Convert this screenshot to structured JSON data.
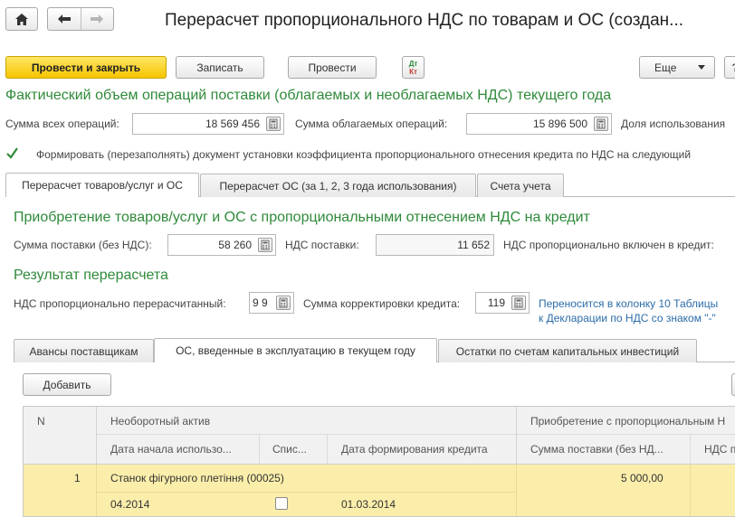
{
  "window": {
    "title": "Перерасчет пропорционального НДС по товарам и ОС (создан..."
  },
  "toolbar": {
    "post_close_label": "Провести и закрыть",
    "save_label": "Записать",
    "post_label": "Провести",
    "dt_kt_label_top": "Дт",
    "dt_kt_label_bottom": "Кт",
    "more_label": "Еще",
    "help_label": "?"
  },
  "section_main": {
    "heading": "Фактический объем операций поставки (облагаемых и необлагаемых НДС) текущего года",
    "sum_all_label": "Сумма всех операций:",
    "sum_all_value": "18 569 456",
    "sum_taxable_label": "Сумма облагаемых операций:",
    "sum_taxable_value": "15 896 500",
    "share_label": "Доля использования",
    "checkbox_checked": true,
    "checkbox_label": "Формировать (перезаполнять) документ установки коэффициента пропорционального отнесения кредита по НДС на следующий"
  },
  "tabs": [
    {
      "label": "Перерасчет товаров/услуг и ОС",
      "active": true
    },
    {
      "label": "Перерасчет ОС (за 1, 2, 3 года использования)",
      "active": false
    },
    {
      "label": "Счета учета",
      "active": false
    }
  ],
  "acquisition": {
    "heading": "Приобретение товаров/услуг и ОС с пропорциональными отнесением НДС на кредит",
    "supply_sum_label": "Сумма поставки (без НДС):",
    "supply_sum_value": "58 260",
    "vat_supply_label": "НДС поставки:",
    "vat_supply_value": "11 652",
    "vat_included_label": "НДС пропорционально включен в кредит:"
  },
  "result": {
    "heading": "Результат перерасчета",
    "recalc_label": "НДС пропорционально перерасчитанный:",
    "recalc_value": "9 9",
    "adjust_label": "Сумма корректировки кредита:",
    "adjust_value": "119",
    "note_line1": "Переносится в колонку 10 Таблицы",
    "note_line2": "к Декларации по НДС со знаком \"-\""
  },
  "subtabs": [
    {
      "label": "Авансы поставщикам",
      "active": false
    },
    {
      "label": "ОС, введенные в эксплуатацию в текущем году",
      "active": true
    },
    {
      "label": "Остатки по счетам капитальных инвестиций",
      "active": false
    }
  ],
  "table": {
    "add_label": "Добавить",
    "col_n": "N",
    "col_asset": "Необоротный актив",
    "col_acq_group": "Приобретение с пропорциональным Н",
    "col_start_date": "Дата начала использо...",
    "col_writeoff": "Спис...",
    "col_credit_date": "Дата формирования кредита",
    "col_supply_sum": "Сумма поставки (без НД...",
    "col_vat": "НДС п",
    "rows": [
      {
        "n": "1",
        "asset": "Станок фігурного плетіння (00025)",
        "start_date": "04.2014",
        "writeoff_checked": false,
        "credit_date": "01.03.2014",
        "supply_sum": "5 000,00"
      }
    ]
  },
  "colors": {
    "accent_green": "#2f8a3a",
    "link_blue": "#2b6ca8",
    "primary_button": "#f6c500",
    "selected_row": "#fbeeab"
  }
}
